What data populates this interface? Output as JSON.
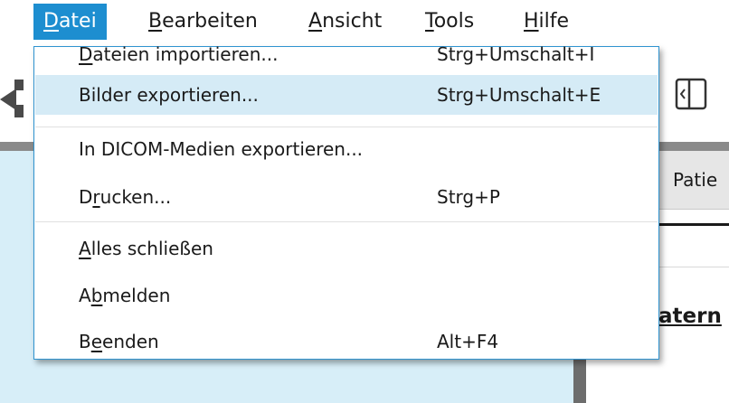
{
  "menubar": {
    "items": [
      {
        "pre": "",
        "ul": "D",
        "post": "atei"
      },
      {
        "pre": "",
        "ul": "B",
        "post": "earbeiten"
      },
      {
        "pre": "",
        "ul": "A",
        "post": "nsicht"
      },
      {
        "pre": "",
        "ul": "T",
        "post": "ools"
      },
      {
        "pre": "",
        "ul": "H",
        "post": "ilfe"
      }
    ],
    "active_index": 0
  },
  "dropdown": {
    "items": [
      {
        "pre": "",
        "ul": "D",
        "post": "ateien importieren...",
        "shortcut": "Strg+Umschalt+I"
      },
      {
        "pre": "Bilder exportieren...",
        "ul": "",
        "post": "",
        "shortcut": "Strg+Umschalt+E"
      },
      {
        "pre": "In DICOM-Medien exportieren...",
        "ul": "",
        "post": "",
        "shortcut": ""
      },
      {
        "pre": "D",
        "ul": "r",
        "post": "ucken...",
        "shortcut": "Strg+P"
      },
      {
        "pre": "",
        "ul": "A",
        "post": "lles schließen",
        "shortcut": ""
      },
      {
        "pre": "A",
        "ul": "b",
        "post": "melden",
        "shortcut": ""
      },
      {
        "pre": "B",
        "ul": "e",
        "post": "enden",
        "shortcut": "Alt+F4"
      }
    ],
    "hover_index": 1
  },
  "background": {
    "patient_header_text": "Patie",
    "heading_text": "atern"
  },
  "colors": {
    "accent": "#1d8ed0",
    "hover": "#d5ebf6",
    "left_pane": "#d7eef8"
  }
}
